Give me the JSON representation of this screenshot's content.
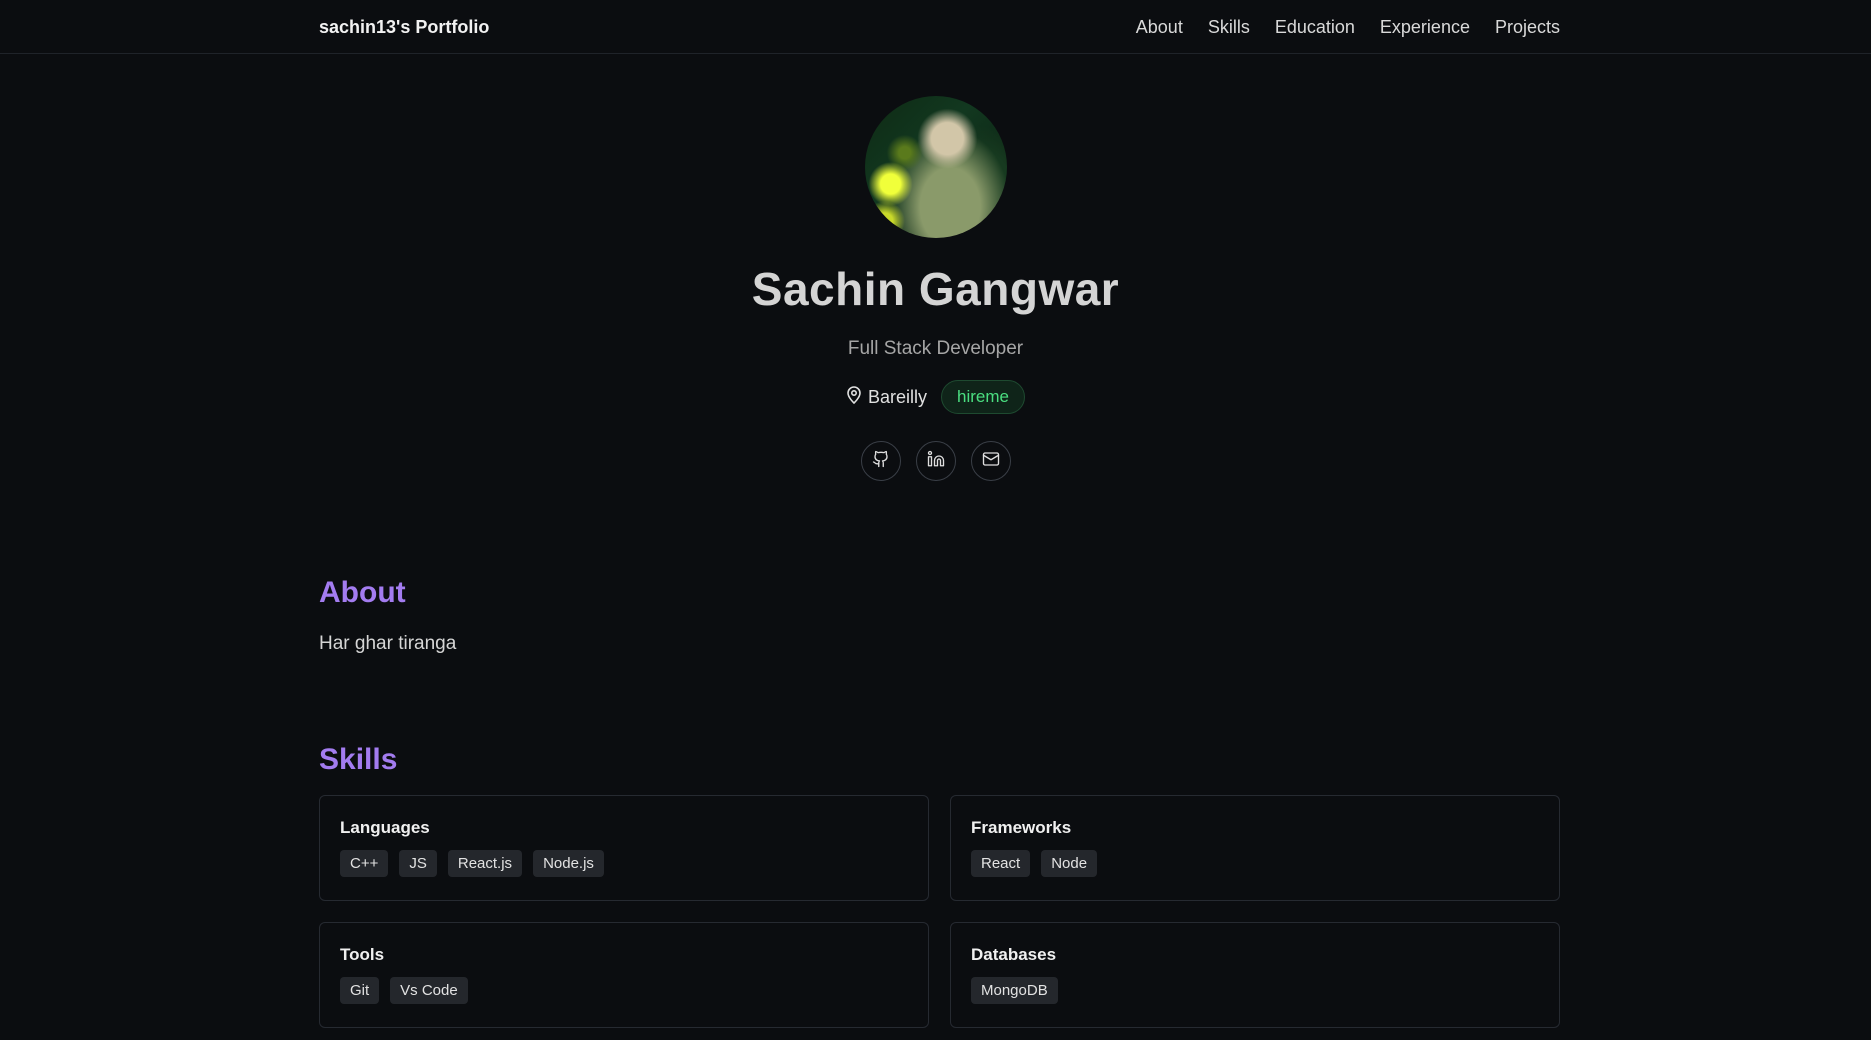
{
  "nav": {
    "brand": "sachin13's Portfolio",
    "links": [
      "About",
      "Skills",
      "Education",
      "Experience",
      "Projects"
    ]
  },
  "hero": {
    "avatar_alt": "profile photo",
    "name": "Sachin Gangwar",
    "role": "Full Stack Developer",
    "location": "Bareilly",
    "badge": "hireme",
    "socials": [
      "github-icon",
      "linkedin-icon",
      "mail-icon"
    ]
  },
  "about": {
    "title": "About",
    "text": "Har ghar tiranga"
  },
  "skills": {
    "title": "Skills",
    "groups": [
      {
        "title": "Languages",
        "items": [
          "C++",
          "JS",
          "React.js",
          "Node.js"
        ]
      },
      {
        "title": "Frameworks",
        "items": [
          "React",
          "Node"
        ]
      },
      {
        "title": "Tools",
        "items": [
          "Git",
          "Vs Code"
        ]
      },
      {
        "title": "Databases",
        "items": [
          "MongoDB"
        ]
      }
    ]
  },
  "colors": {
    "background": "#0b0d10",
    "accent": "#a37cf0",
    "badge_green": "#4ade80"
  }
}
